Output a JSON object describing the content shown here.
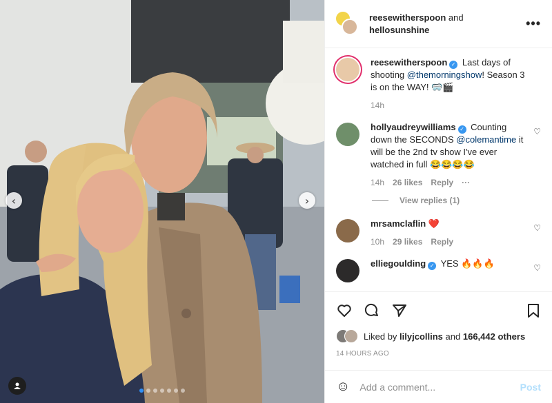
{
  "header": {
    "user1": "reesewitherspoon",
    "and_text": "and",
    "user2": "hellosunshine",
    "more_label": "•••"
  },
  "caption": {
    "username": "reesewitherspoon",
    "text_a": "Last days of shooting",
    "mention": "@themorningshow",
    "text_b": "! Season 3 is on the WAY! 🥽🎬",
    "age": "14h"
  },
  "comments": [
    {
      "username": "hollyaudreywilliams",
      "text_a": "Counting down the SECONDS",
      "mention": "@colemantime",
      "text_b": "it will be the 2nd tv show I've ever watched in full 😂😂😂😂",
      "age": "14h",
      "likes": "26 likes",
      "reply": "Reply",
      "more": "···",
      "view_replies": "View replies (1)"
    },
    {
      "username": "mrsamclaflin",
      "text": "❤️",
      "age": "10h",
      "likes": "29 likes",
      "reply": "Reply"
    },
    {
      "username": "elliegoulding",
      "text": "YES 🔥🔥🔥"
    }
  ],
  "likes": {
    "prefix": "Liked by",
    "user": "lilyjcollins",
    "mid": "and",
    "count": "166,442 others"
  },
  "timestamp": "14 HOURS AGO",
  "add_comment": {
    "placeholder": "Add a comment...",
    "post_label": "Post"
  },
  "carousel": {
    "prev_icon": "chevron-left-icon",
    "next_icon": "chevron-right-icon",
    "dot_count": 7,
    "active_dot": 1
  },
  "colors": {
    "verified": "#3897f0",
    "link": "#00376b",
    "active_dot": "#2f8ff5",
    "post_disabled": "#b2dffc"
  }
}
